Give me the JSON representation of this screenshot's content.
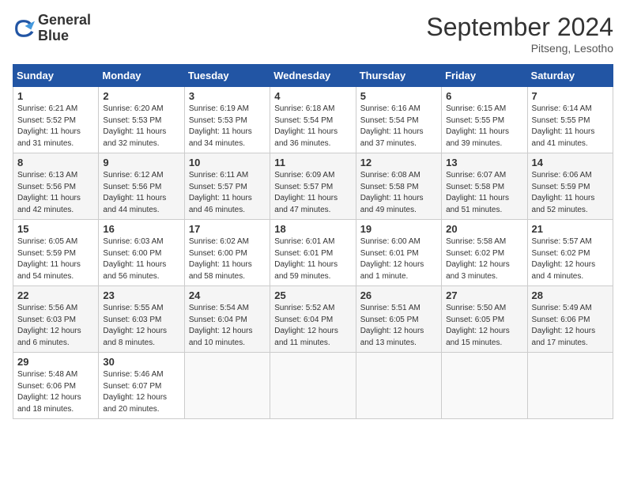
{
  "header": {
    "logo_line1": "General",
    "logo_line2": "Blue",
    "month": "September 2024",
    "location": "Pitseng, Lesotho"
  },
  "days": [
    "Sunday",
    "Monday",
    "Tuesday",
    "Wednesday",
    "Thursday",
    "Friday",
    "Saturday"
  ],
  "weeks": [
    [
      {
        "num": "1",
        "sunrise": "6:21 AM",
        "sunset": "5:52 PM",
        "daylight": "11 hours and 31 minutes."
      },
      {
        "num": "2",
        "sunrise": "6:20 AM",
        "sunset": "5:53 PM",
        "daylight": "11 hours and 32 minutes."
      },
      {
        "num": "3",
        "sunrise": "6:19 AM",
        "sunset": "5:53 PM",
        "daylight": "11 hours and 34 minutes."
      },
      {
        "num": "4",
        "sunrise": "6:18 AM",
        "sunset": "5:54 PM",
        "daylight": "11 hours and 36 minutes."
      },
      {
        "num": "5",
        "sunrise": "6:16 AM",
        "sunset": "5:54 PM",
        "daylight": "11 hours and 37 minutes."
      },
      {
        "num": "6",
        "sunrise": "6:15 AM",
        "sunset": "5:55 PM",
        "daylight": "11 hours and 39 minutes."
      },
      {
        "num": "7",
        "sunrise": "6:14 AM",
        "sunset": "5:55 PM",
        "daylight": "11 hours and 41 minutes."
      }
    ],
    [
      {
        "num": "8",
        "sunrise": "6:13 AM",
        "sunset": "5:56 PM",
        "daylight": "11 hours and 42 minutes."
      },
      {
        "num": "9",
        "sunrise": "6:12 AM",
        "sunset": "5:56 PM",
        "daylight": "11 hours and 44 minutes."
      },
      {
        "num": "10",
        "sunrise": "6:11 AM",
        "sunset": "5:57 PM",
        "daylight": "11 hours and 46 minutes."
      },
      {
        "num": "11",
        "sunrise": "6:09 AM",
        "sunset": "5:57 PM",
        "daylight": "11 hours and 47 minutes."
      },
      {
        "num": "12",
        "sunrise": "6:08 AM",
        "sunset": "5:58 PM",
        "daylight": "11 hours and 49 minutes."
      },
      {
        "num": "13",
        "sunrise": "6:07 AM",
        "sunset": "5:58 PM",
        "daylight": "11 hours and 51 minutes."
      },
      {
        "num": "14",
        "sunrise": "6:06 AM",
        "sunset": "5:59 PM",
        "daylight": "11 hours and 52 minutes."
      }
    ],
    [
      {
        "num": "15",
        "sunrise": "6:05 AM",
        "sunset": "5:59 PM",
        "daylight": "11 hours and 54 minutes."
      },
      {
        "num": "16",
        "sunrise": "6:03 AM",
        "sunset": "6:00 PM",
        "daylight": "11 hours and 56 minutes."
      },
      {
        "num": "17",
        "sunrise": "6:02 AM",
        "sunset": "6:00 PM",
        "daylight": "11 hours and 58 minutes."
      },
      {
        "num": "18",
        "sunrise": "6:01 AM",
        "sunset": "6:01 PM",
        "daylight": "11 hours and 59 minutes."
      },
      {
        "num": "19",
        "sunrise": "6:00 AM",
        "sunset": "6:01 PM",
        "daylight": "12 hours and 1 minute."
      },
      {
        "num": "20",
        "sunrise": "5:58 AM",
        "sunset": "6:02 PM",
        "daylight": "12 hours and 3 minutes."
      },
      {
        "num": "21",
        "sunrise": "5:57 AM",
        "sunset": "6:02 PM",
        "daylight": "12 hours and 4 minutes."
      }
    ],
    [
      {
        "num": "22",
        "sunrise": "5:56 AM",
        "sunset": "6:03 PM",
        "daylight": "12 hours and 6 minutes."
      },
      {
        "num": "23",
        "sunrise": "5:55 AM",
        "sunset": "6:03 PM",
        "daylight": "12 hours and 8 minutes."
      },
      {
        "num": "24",
        "sunrise": "5:54 AM",
        "sunset": "6:04 PM",
        "daylight": "12 hours and 10 minutes."
      },
      {
        "num": "25",
        "sunrise": "5:52 AM",
        "sunset": "6:04 PM",
        "daylight": "12 hours and 11 minutes."
      },
      {
        "num": "26",
        "sunrise": "5:51 AM",
        "sunset": "6:05 PM",
        "daylight": "12 hours and 13 minutes."
      },
      {
        "num": "27",
        "sunrise": "5:50 AM",
        "sunset": "6:05 PM",
        "daylight": "12 hours and 15 minutes."
      },
      {
        "num": "28",
        "sunrise": "5:49 AM",
        "sunset": "6:06 PM",
        "daylight": "12 hours and 17 minutes."
      }
    ],
    [
      {
        "num": "29",
        "sunrise": "5:48 AM",
        "sunset": "6:06 PM",
        "daylight": "12 hours and 18 minutes."
      },
      {
        "num": "30",
        "sunrise": "5:46 AM",
        "sunset": "6:07 PM",
        "daylight": "12 hours and 20 minutes."
      },
      null,
      null,
      null,
      null,
      null
    ]
  ]
}
